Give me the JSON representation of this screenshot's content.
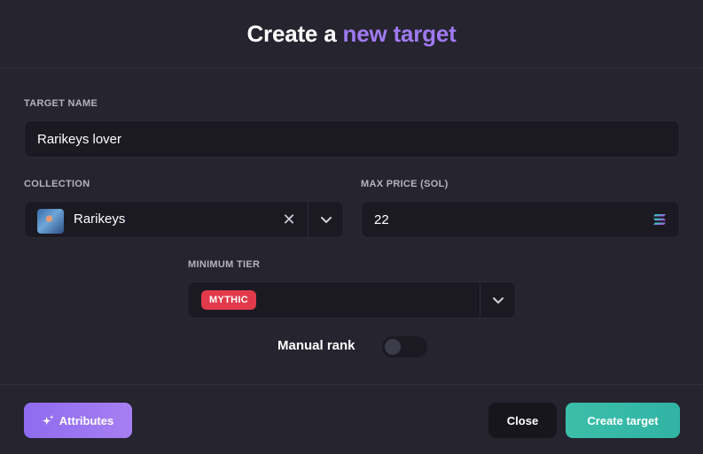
{
  "header": {
    "title_part1": "Create a",
    "title_accent": "new target"
  },
  "form": {
    "target_name": {
      "label": "TARGET NAME",
      "value": "Rarikeys lover"
    },
    "collection": {
      "label": "COLLECTION",
      "value": "Rarikeys"
    },
    "max_price": {
      "label": "MAX PRICE (SOL)",
      "value": "22",
      "icon": "solana-icon"
    },
    "minimum_tier": {
      "label": "MINIMUM TIER",
      "value": "MYTHIC",
      "badge_color": "#e23a4b"
    },
    "manual_rank": {
      "label": "Manual rank",
      "enabled": false
    }
  },
  "footer": {
    "attributes_label": "Attributes",
    "close_label": "Close",
    "create_label": "Create target"
  },
  "colors": {
    "accent_purple": "#a07af0",
    "create_teal": "#3bbfaa",
    "background": "#25242f"
  }
}
